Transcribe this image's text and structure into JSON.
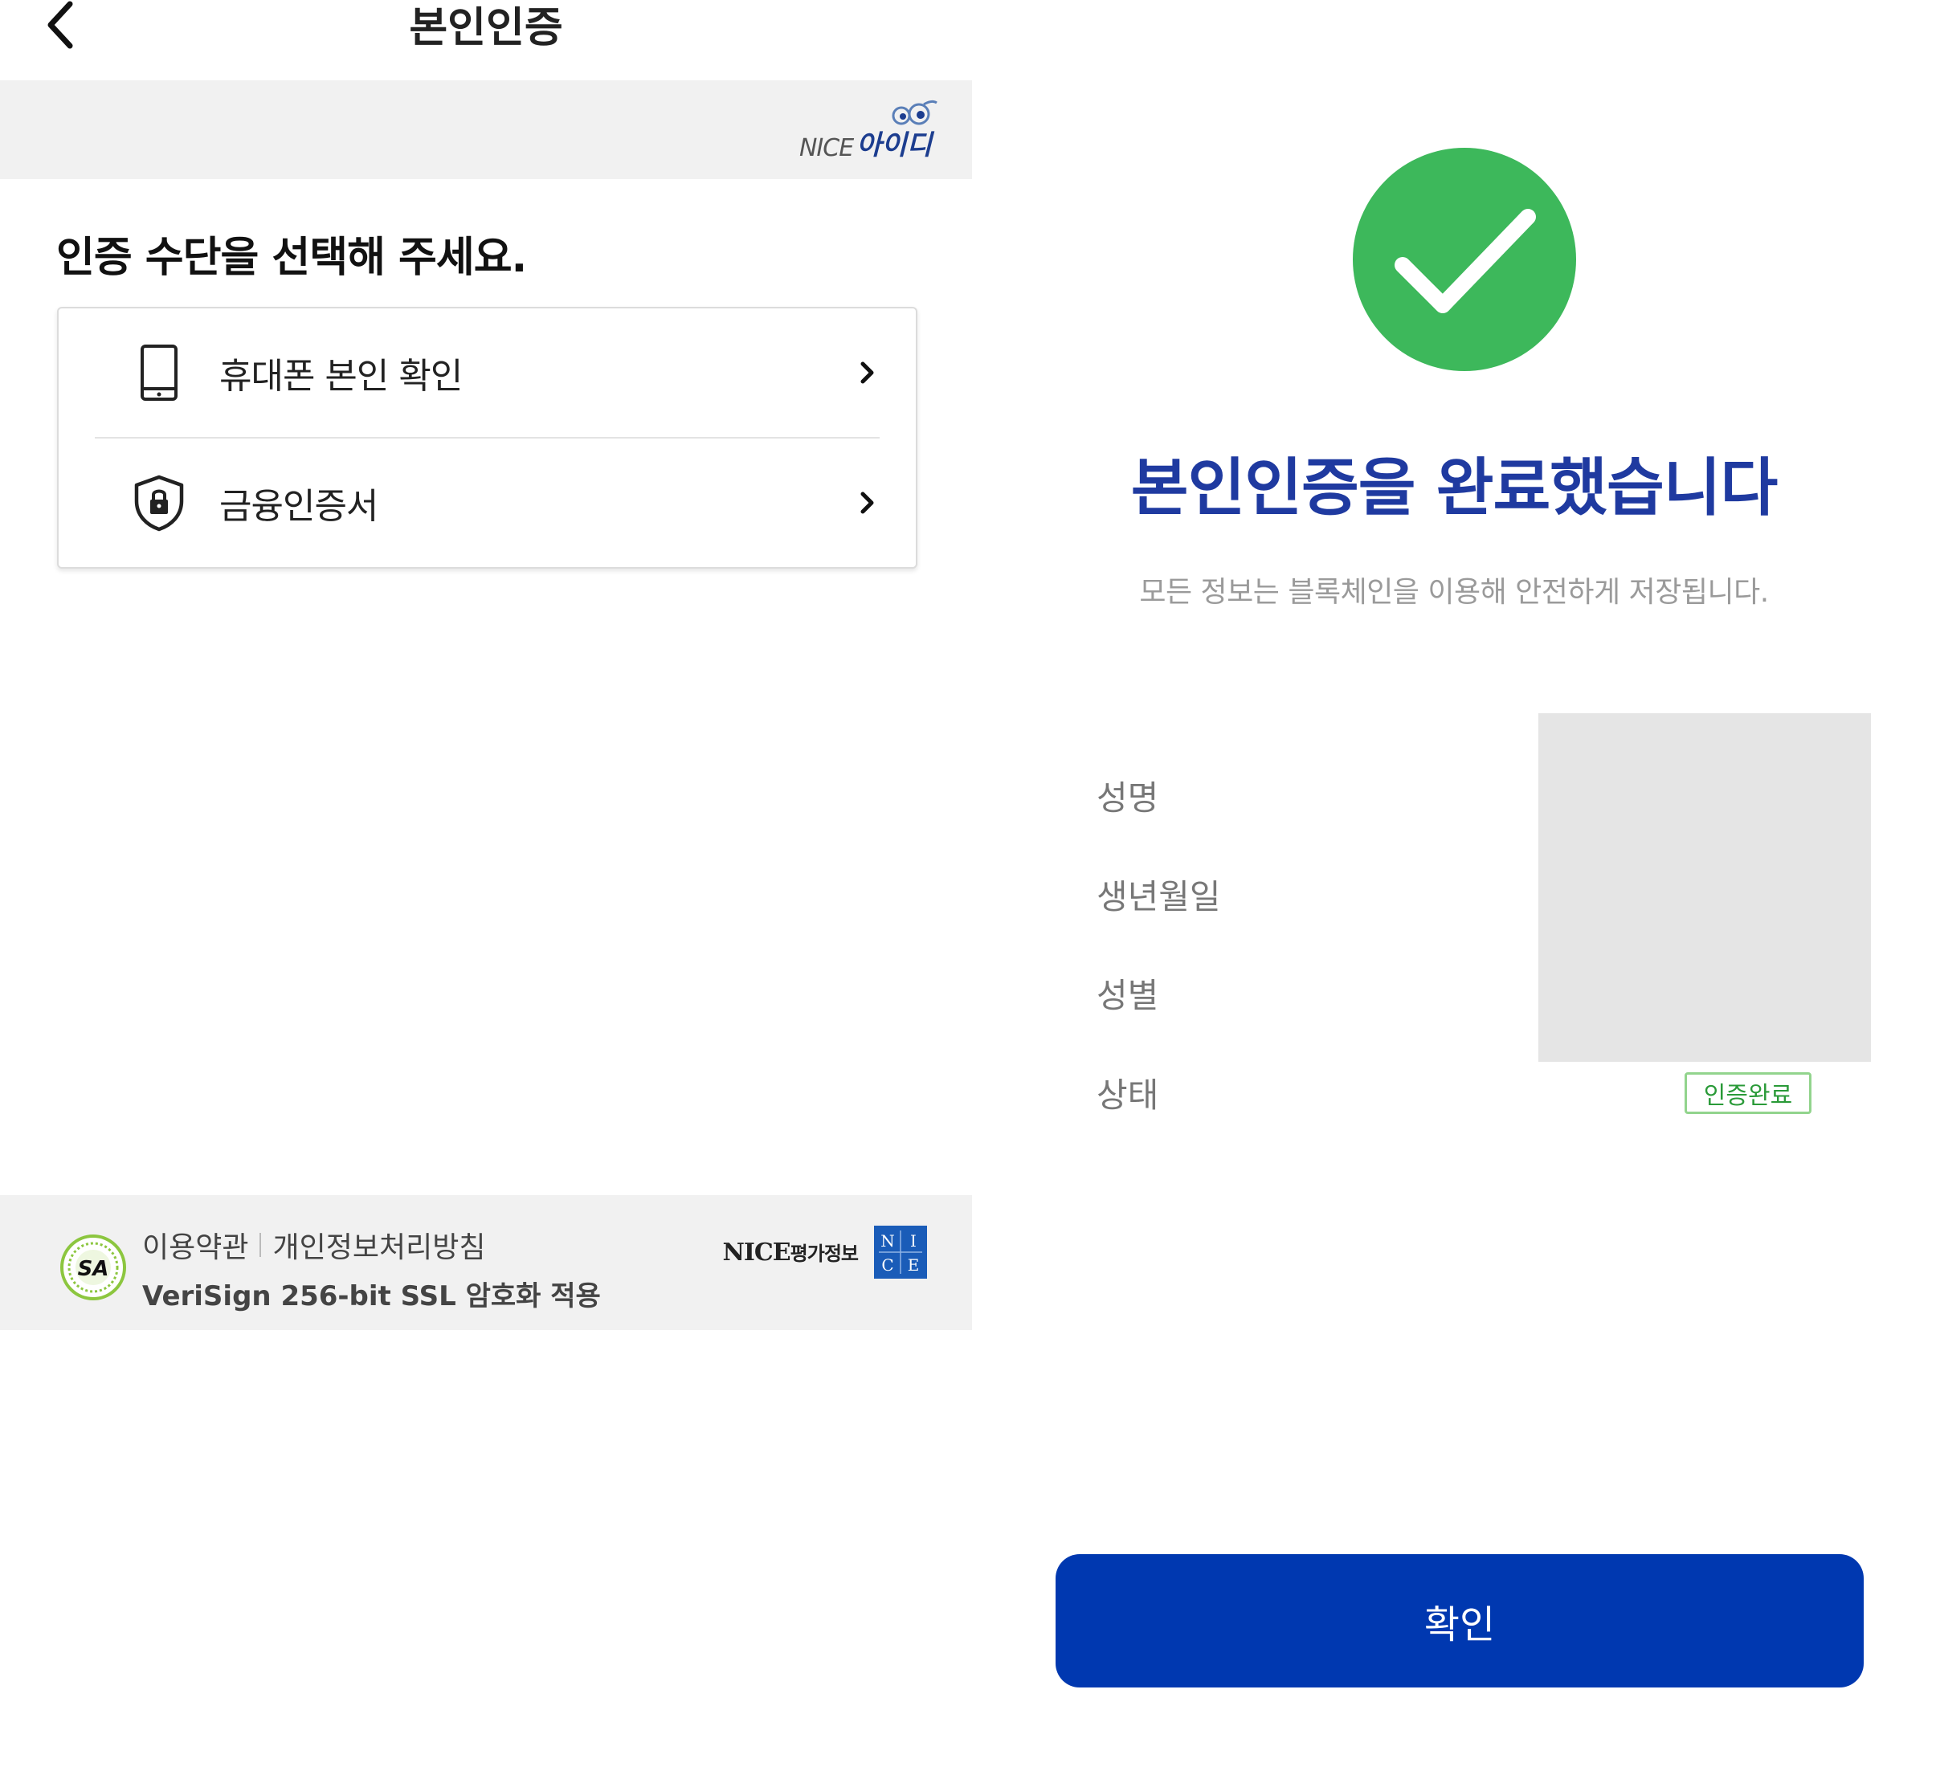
{
  "auth_select": {
    "header": {
      "title": "본인인증",
      "back_icon": "chevron-left-icon"
    },
    "brand": {
      "logo_prefix": "NICE",
      "logo_name": "아이디"
    },
    "heading": "인증 수단을 선택해 주세요.",
    "methods": [
      {
        "label": "휴대폰 본인 확인",
        "icon": "mobile-phone-icon"
      },
      {
        "label": "금융인증서",
        "icon": "shield-lock-icon"
      }
    ],
    "footer": {
      "links": [
        "이용약관",
        "개인정보처리방침"
      ],
      "security_note": "VeriSign 256-bit SSL 암호화 적용",
      "sa_badge": "SA",
      "company_name": "NICE",
      "company_suffix": "평가정보",
      "company_logo_letters": [
        "N",
        "I",
        "C",
        "E"
      ]
    }
  },
  "auth_complete": {
    "icon": "check-circle-icon",
    "title": "본인인증을 완료했습니다",
    "subtitle": "모든 정보는 블록체인을 이용해 안전하게 저장됩니다.",
    "fields": [
      {
        "label": "성명"
      },
      {
        "label": "생년월일"
      },
      {
        "label": "성별"
      },
      {
        "label": "상태",
        "value": "인증완료"
      }
    ],
    "confirm_label": "확인"
  },
  "colors": {
    "primary": "#0038b0",
    "title_blue": "#1f3aa0",
    "success_green": "#3db85b",
    "badge_green": "#2a9a38",
    "strip_gray": "#f1f1f1"
  }
}
